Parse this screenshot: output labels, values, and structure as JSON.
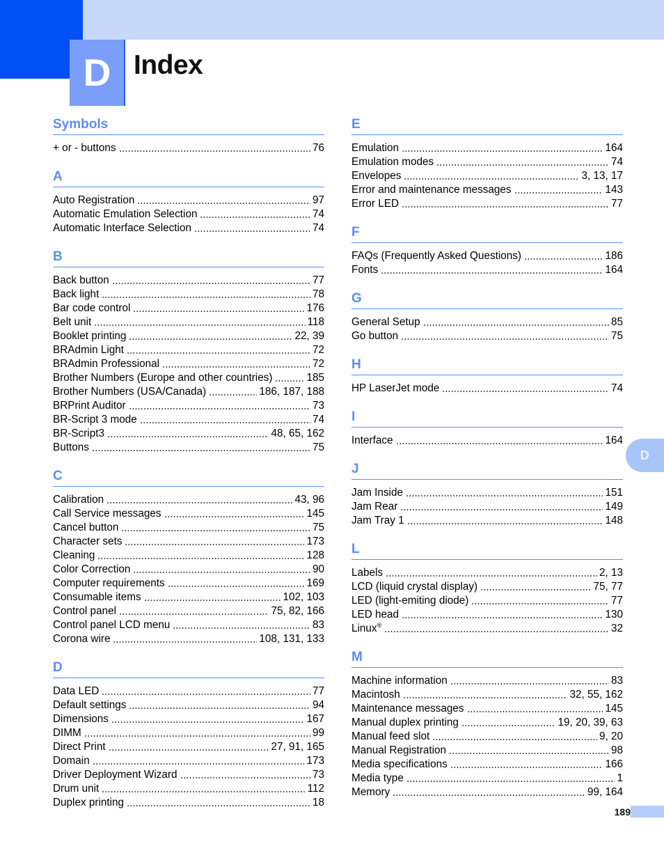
{
  "header": {
    "chapter_letter": "D",
    "title": "Index",
    "band_color": "#c7d8fb",
    "block_color": "#0050f5",
    "badge_color": "#7c9efb"
  },
  "side_tab": {
    "label": "D",
    "color": "#a9c4f7"
  },
  "footer": {
    "page_number": "189",
    "block_color": "#b7cdf9"
  },
  "accent_color": "#5d8cf8",
  "columns": {
    "left": [
      {
        "letter": "Symbols",
        "entries": [
          {
            "title": "+ or - buttons",
            "pages": "76"
          }
        ]
      },
      {
        "letter": "A",
        "entries": [
          {
            "title": "Auto Registration",
            "pages": "97"
          },
          {
            "title": "Automatic Emulation Selection",
            "pages": "74"
          },
          {
            "title": "Automatic Interface Selection",
            "pages": "74"
          }
        ]
      },
      {
        "letter": "B",
        "entries": [
          {
            "title": "Back button",
            "pages": "77"
          },
          {
            "title": "Back light",
            "pages": "78"
          },
          {
            "title": "Bar code control",
            "pages": "176"
          },
          {
            "title": "Belt unit",
            "pages": "118"
          },
          {
            "title": "Booklet printing",
            "pages": "22, 39"
          },
          {
            "title": "BRAdmin Light",
            "pages": "72"
          },
          {
            "title": "BRAdmin Professional",
            "pages": "72"
          },
          {
            "title": "Brother Numbers (Europe and other countries)",
            "pages": "185"
          },
          {
            "title": "Brother Numbers (USA/Canada)",
            "pages": "186, 187, 188"
          },
          {
            "title": "BRPrint Auditor",
            "pages": "73"
          },
          {
            "title": "BR-Script 3 mode",
            "pages": "74"
          },
          {
            "title": "BR-Script3",
            "pages": "48, 65, 162"
          },
          {
            "title": "Buttons",
            "pages": "75"
          }
        ]
      },
      {
        "letter": "C",
        "entries": [
          {
            "title": "Calibration",
            "pages": "43, 96"
          },
          {
            "title": "Call Service messages",
            "pages": "145"
          },
          {
            "title": "Cancel button",
            "pages": "75"
          },
          {
            "title": "Character sets",
            "pages": "173"
          },
          {
            "title": "Cleaning",
            "pages": "128"
          },
          {
            "title": "Color Correction",
            "pages": "90"
          },
          {
            "title": "Computer requirements",
            "pages": "169"
          },
          {
            "title": "Consumable items",
            "pages": "102, 103"
          },
          {
            "title": "Control panel",
            "pages": "75, 82, 166"
          },
          {
            "title": "Control panel LCD menu",
            "pages": "83"
          },
          {
            "title": "Corona wire",
            "pages": "108, 131, 133"
          }
        ]
      },
      {
        "letter": "D",
        "entries": [
          {
            "title": "Data LED",
            "pages": "77"
          },
          {
            "title": "Default settings",
            "pages": "94"
          },
          {
            "title": "Dimensions",
            "pages": "167"
          },
          {
            "title": "DIMM",
            "pages": "99"
          },
          {
            "title": "Direct Print",
            "pages": "27, 91, 165"
          },
          {
            "title": "Domain",
            "pages": "173"
          },
          {
            "title": "Driver Deployment Wizard",
            "pages": "73"
          },
          {
            "title": "Drum unit",
            "pages": "112"
          },
          {
            "title": "Duplex printing",
            "pages": "18"
          }
        ]
      }
    ],
    "right": [
      {
        "letter": "E",
        "entries": [
          {
            "title": "Emulation",
            "pages": "164"
          },
          {
            "title": "Emulation modes",
            "pages": "74"
          },
          {
            "title": "Envelopes",
            "pages": "3, 13, 17"
          },
          {
            "title": "Error and maintenance messages",
            "pages": "143"
          },
          {
            "title": "Error LED",
            "pages": "77"
          }
        ]
      },
      {
        "letter": "F",
        "entries": [
          {
            "title": "FAQs (Frequently Asked Questions)",
            "pages": "186"
          },
          {
            "title": "Fonts",
            "pages": "164"
          }
        ]
      },
      {
        "letter": "G",
        "entries": [
          {
            "title": "General Setup",
            "pages": "85"
          },
          {
            "title": "Go button",
            "pages": "75"
          }
        ]
      },
      {
        "letter": "H",
        "entries": [
          {
            "title": "HP LaserJet mode",
            "pages": "74"
          }
        ]
      },
      {
        "letter": "I",
        "entries": [
          {
            "title": "Interface",
            "pages": "164"
          }
        ]
      },
      {
        "letter": "J",
        "entries": [
          {
            "title": "Jam Inside",
            "pages": "151"
          },
          {
            "title": "Jam Rear",
            "pages": "149"
          },
          {
            "title": "Jam Tray 1",
            "pages": "148"
          }
        ]
      },
      {
        "letter": "L",
        "entries": [
          {
            "title": "Labels",
            "pages": "2, 13"
          },
          {
            "title": "LCD (liquid crystal display)",
            "pages": "75, 77"
          },
          {
            "title": "LED (light-emiting diode)",
            "pages": "77"
          },
          {
            "title": "LED head",
            "pages": "130"
          },
          {
            "title": "Linux",
            "superscript": "®",
            "pages": "32"
          }
        ]
      },
      {
        "letter": "M",
        "entries": [
          {
            "title": "Machine information",
            "pages": "83"
          },
          {
            "title": "Macintosh",
            "pages": "32, 55, 162"
          },
          {
            "title": "Maintenance messages",
            "pages": "145"
          },
          {
            "title": "Manual duplex printing",
            "pages": "19, 20, 39, 63"
          },
          {
            "title": "Manual feed slot",
            "pages": "9, 20"
          },
          {
            "title": "Manual Registration",
            "pages": "98"
          },
          {
            "title": "Media specifications",
            "pages": "166"
          },
          {
            "title": "Media type",
            "pages": "1"
          },
          {
            "title": "Memory",
            "pages": "99, 164"
          }
        ]
      }
    ]
  }
}
